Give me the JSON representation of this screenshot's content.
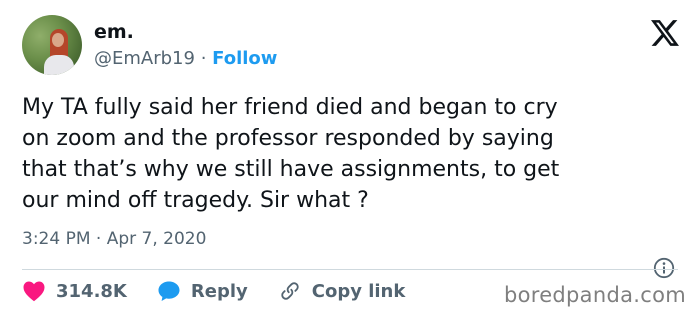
{
  "author": {
    "name": "em.",
    "handle": "@EmArb19",
    "separator": "·",
    "follow_label": "Follow"
  },
  "tweet": {
    "lines": [
      "My TA fully said her friend died and began to cry",
      "on zoom and the professor responded by saying",
      "that that’s why we still have assignments, to get",
      "our mind off tragedy. Sir what ?"
    ],
    "timestamp": "3:24 PM · Apr 7, 2020"
  },
  "actions": {
    "like_count": "314.8K",
    "reply_label": "Reply",
    "copy_link_label": "Copy link"
  },
  "icons": {
    "platform_logo": "x-logo-icon",
    "info": "info-icon",
    "like": "heart-icon",
    "reply": "speech-bubble-icon",
    "copy_link": "link-icon"
  },
  "colors": {
    "like": "#f91880",
    "reply": "#1d9bf0",
    "follow": "#1d9bf0",
    "secondary_text": "#536471"
  },
  "watermark": "boredpanda.com"
}
